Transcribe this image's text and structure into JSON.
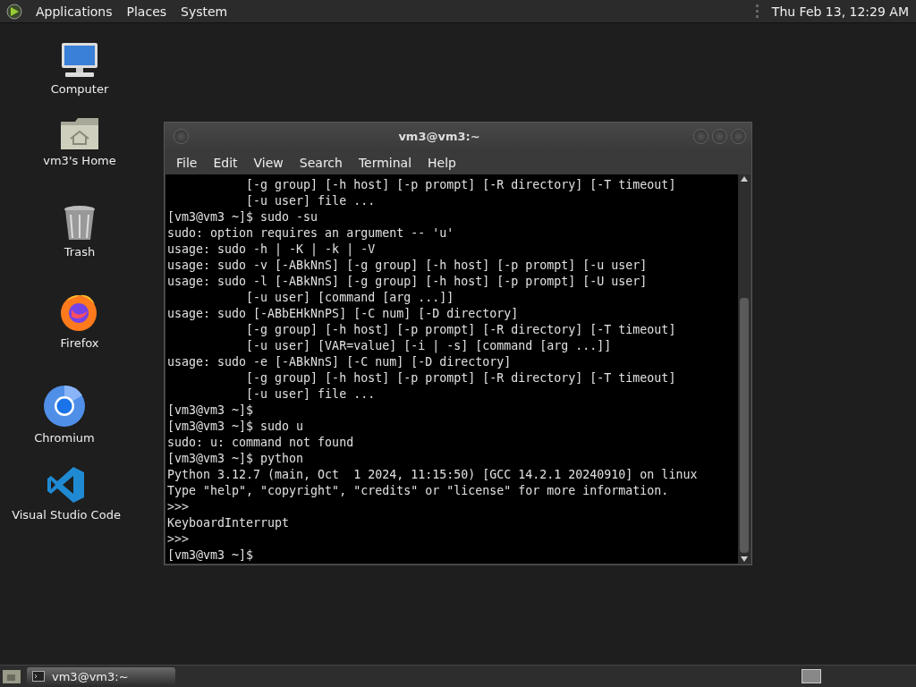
{
  "top_panel": {
    "menus": [
      "Applications",
      "Places",
      "System"
    ],
    "clock": "Thu Feb 13, 12:29 AM"
  },
  "desktop_icons": [
    {
      "kind": "computer",
      "label": "Computer"
    },
    {
      "kind": "home",
      "label": "vm3's Home"
    },
    {
      "kind": "trash",
      "label": "Trash"
    },
    {
      "kind": "firefox",
      "label": "Firefox"
    },
    {
      "kind": "chromium",
      "label": "Chromium"
    },
    {
      "kind": "vscode",
      "label": "Visual Studio Code"
    }
  ],
  "terminal": {
    "title": "vm3@vm3:~",
    "menu": [
      "File",
      "Edit",
      "View",
      "Search",
      "Terminal",
      "Help"
    ],
    "lines": [
      "           [-g group] [-h host] [-p prompt] [-R directory] [-T timeout]",
      "           [-u user] file ...",
      "[vm3@vm3 ~]$ sudo -su",
      "sudo: option requires an argument -- 'u'",
      "usage: sudo -h | -K | -k | -V",
      "usage: sudo -v [-ABkNnS] [-g group] [-h host] [-p prompt] [-u user]",
      "usage: sudo -l [-ABkNnS] [-g group] [-h host] [-p prompt] [-U user]",
      "           [-u user] [command [arg ...]]",
      "usage: sudo [-ABbEHkNnPS] [-C num] [-D directory]",
      "           [-g group] [-h host] [-p prompt] [-R directory] [-T timeout]",
      "           [-u user] [VAR=value] [-i | -s] [command [arg ...]]",
      "usage: sudo -e [-ABkNnS] [-C num] [-D directory]",
      "           [-g group] [-h host] [-p prompt] [-R directory] [-T timeout]",
      "           [-u user] file ...",
      "[vm3@vm3 ~]$",
      "[vm3@vm3 ~]$ sudo u",
      "sudo: u: command not found",
      "[vm3@vm3 ~]$ python",
      "Python 3.12.7 (main, Oct  1 2024, 11:15:50) [GCC 14.2.1 20240910] on linux",
      "Type \"help\", \"copyright\", \"credits\" or \"license\" for more information.",
      ">>>",
      "KeyboardInterrupt",
      ">>>",
      "[vm3@vm3 ~]$"
    ]
  },
  "taskbar": {
    "tasks": [
      {
        "label": "vm3@vm3:~",
        "selected": true
      }
    ]
  }
}
